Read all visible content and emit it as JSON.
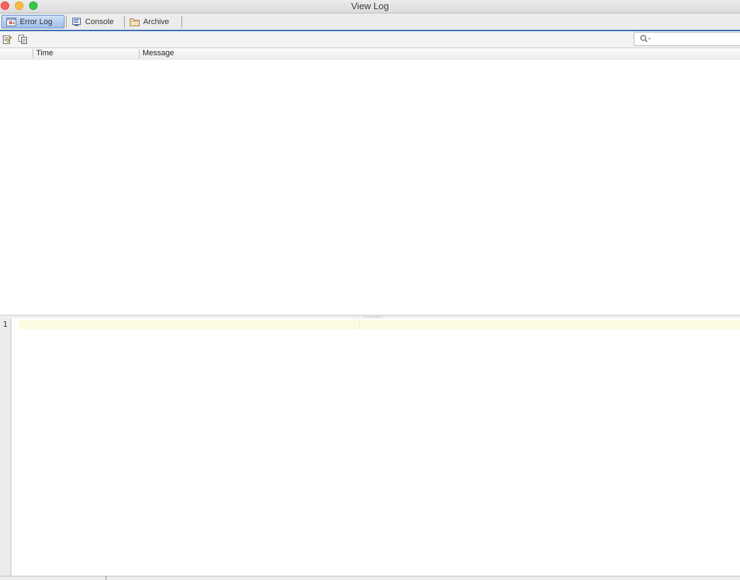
{
  "window": {
    "title": "View Log"
  },
  "tabs": [
    {
      "label": "Error Log",
      "icon": "error-log-icon",
      "active": true
    },
    {
      "label": "Console",
      "icon": "console-icon",
      "active": false
    },
    {
      "label": "Archive",
      "icon": "folder-icon",
      "active": false
    }
  ],
  "toolbar": {
    "icons": [
      "edit-notes-icon",
      "copy-icon"
    ],
    "search": {
      "value": "",
      "placeholder": ""
    }
  },
  "table": {
    "columns": [
      "",
      "Time",
      "Message"
    ],
    "rows": []
  },
  "editor": {
    "line_numbers": [
      "1"
    ],
    "content": ""
  },
  "colors": {
    "accent": "#3b6fb7",
    "current_line": "#fdfbe2"
  }
}
